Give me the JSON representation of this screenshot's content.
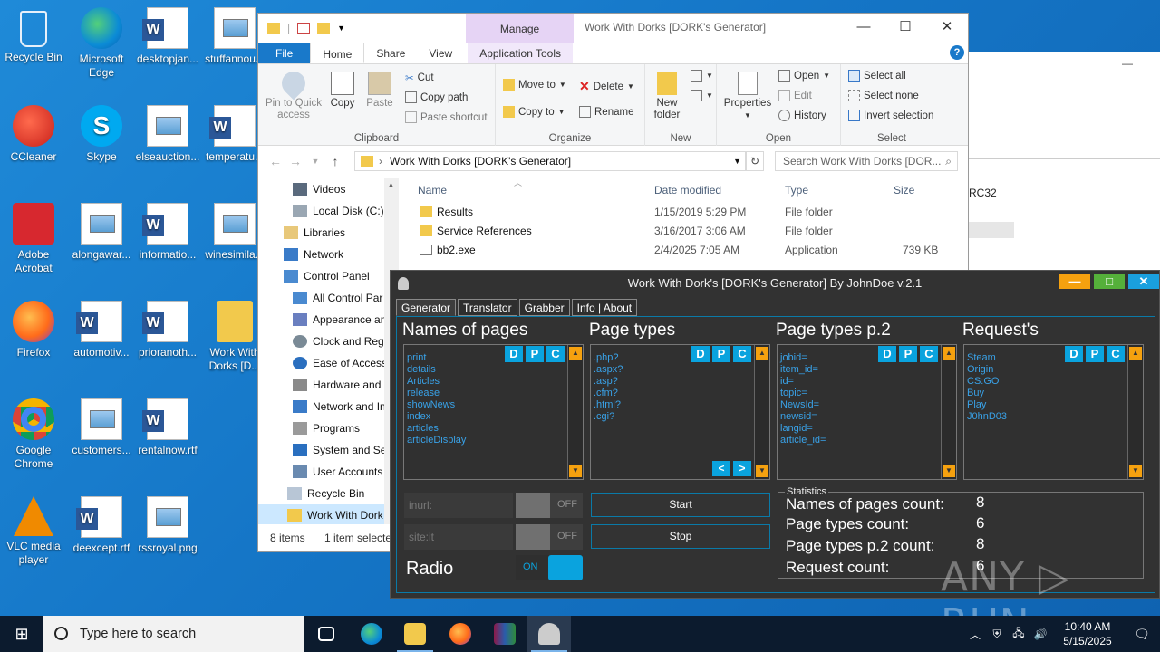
{
  "desktop": {
    "icons": [
      {
        "label": "Recycle Bin",
        "icon": "recycle-bin-icon"
      },
      {
        "label": "Microsoft Edge",
        "icon": "edge-icon"
      },
      {
        "label": "desktopjan...",
        "icon": "word-doc-icon"
      },
      {
        "label": "stuffannou...",
        "icon": "image-file-icon"
      },
      {
        "label": "CCleaner",
        "icon": "ccleaner-icon"
      },
      {
        "label": "Skype",
        "icon": "skype-icon"
      },
      {
        "label": "elseauction...",
        "icon": "image-file-icon"
      },
      {
        "label": "temperatu...",
        "icon": "word-doc-icon"
      },
      {
        "label": "Adobe Acrobat",
        "icon": "acrobat-icon"
      },
      {
        "label": "alongawar...",
        "icon": "image-file-icon"
      },
      {
        "label": "informatio...",
        "icon": "word-doc-icon"
      },
      {
        "label": "winesimila...",
        "icon": "image-file-icon"
      },
      {
        "label": "Firefox",
        "icon": "firefox-icon"
      },
      {
        "label": "automotiv...",
        "icon": "word-doc-icon"
      },
      {
        "label": "prioranoth...",
        "icon": "word-doc-icon"
      },
      {
        "label": "Work With Dorks [D...",
        "icon": "folder-icon"
      },
      {
        "label": "Google Chrome",
        "icon": "chrome-icon"
      },
      {
        "label": "customers...",
        "icon": "image-file-icon"
      },
      {
        "label": "rentalnow.rtf",
        "icon": "word-doc-icon"
      },
      {
        "label": "VLC media player",
        "icon": "vlc-icon"
      },
      {
        "label": "deexcept.rtf",
        "icon": "word-doc-icon"
      },
      {
        "label": "rssroyal.png",
        "icon": "image-file-icon"
      }
    ]
  },
  "explorer": {
    "title": "Work With Dorks [DORK's Generator]",
    "manage_label": "Manage",
    "tabs": {
      "file": "File",
      "home": "Home",
      "share": "Share",
      "view": "View",
      "app_tools": "Application Tools"
    },
    "help": "?",
    "ribbon": {
      "pin": "Pin to Quick access",
      "copy": "Copy",
      "paste": "Paste",
      "cut": "Cut",
      "copy_path": "Copy path",
      "paste_shortcut": "Paste shortcut",
      "clipboard": "Clipboard",
      "move_to": "Move to",
      "copy_to": "Copy to",
      "delete": "Delete",
      "rename": "Rename",
      "organize": "Organize",
      "new_folder": "New folder",
      "new": "New",
      "properties": "Properties",
      "open": "Open",
      "edit": "Edit",
      "history": "History",
      "open_group": "Open",
      "select_all": "Select all",
      "select_none": "Select none",
      "invert_selection": "Invert selection",
      "select": "Select"
    },
    "address": "Work With Dorks [DORK's Generator]",
    "search_placeholder": "Search Work With Dorks [DOR...",
    "nav_items": [
      {
        "label": "Videos",
        "icon": "videos-folder-icon"
      },
      {
        "label": "Local Disk (C:)",
        "icon": "drive-icon"
      },
      {
        "label": "Libraries",
        "icon": "libraries-icon"
      },
      {
        "label": "Network",
        "icon": "network-icon"
      },
      {
        "label": "Control Panel",
        "icon": "control-panel-icon"
      },
      {
        "label": "All Control Par",
        "icon": "control-panel-icon"
      },
      {
        "label": "Appearance an",
        "icon": "appearance-icon"
      },
      {
        "label": "Clock and Regi",
        "icon": "clock-icon"
      },
      {
        "label": "Ease of Access",
        "icon": "ease-access-icon"
      },
      {
        "label": "Hardware and",
        "icon": "hardware-icon"
      },
      {
        "label": "Network and In",
        "icon": "network-icon"
      },
      {
        "label": "Programs",
        "icon": "programs-icon"
      },
      {
        "label": "System and Se",
        "icon": "shield-icon"
      },
      {
        "label": "User Accounts",
        "icon": "users-icon"
      },
      {
        "label": "Recycle Bin",
        "icon": "recycle-bin-icon"
      },
      {
        "label": "Work With Dork",
        "icon": "folder-icon"
      }
    ],
    "columns": {
      "name": "Name",
      "date": "Date modified",
      "type": "Type",
      "size": "Size"
    },
    "files": [
      {
        "name": "Results",
        "date": "1/15/2019 5:29 PM",
        "type": "File folder",
        "size": ""
      },
      {
        "name": "Service References",
        "date": "3/16/2017 3:06 AM",
        "type": "File folder",
        "size": ""
      },
      {
        "name": "bb2.exe",
        "date": "2/4/2025 7:05 AM",
        "type": "Application",
        "size": "739 KB"
      }
    ],
    "status_items": "8 items",
    "status_selected": "1 item selecte"
  },
  "bg_window": {
    "text": "RC32"
  },
  "dork": {
    "title": "Work With Dork's [DORK's Generator] By JohnDoe v.2.1",
    "tabs": [
      "Generator",
      "Translator",
      "Grabber",
      "Info | About"
    ],
    "columns": [
      {
        "header": "Names of pages",
        "items": [
          "print",
          "details",
          "Articles",
          "release",
          "showNews",
          "index",
          "articles",
          "articleDisplay"
        ]
      },
      {
        "header": "Page types",
        "items": [
          ".php?",
          ".aspx?",
          ".asp?",
          ".cfm?",
          ".html?",
          ".cgi?"
        ]
      },
      {
        "header": "Page types p.2",
        "items": [
          "jobid=",
          "item_id=",
          "id=",
          "topic=",
          "NewsId=",
          "newsid=",
          "langid=",
          "article_id="
        ]
      },
      {
        "header": "Request's",
        "items": [
          "Steam",
          "Origin",
          "CS:GO",
          "Buy",
          "Play",
          "J0hnD03"
        ]
      }
    ],
    "btn_d": "D",
    "btn_p": "P",
    "btn_c": "C",
    "prev": "<",
    "next": ">",
    "inurl_placeholder": "inurl:",
    "site_placeholder": "site:it",
    "off_label": "OFF",
    "on_label": "ON",
    "radio_label": "Radio",
    "start": "Start",
    "stop": "Stop",
    "stats": {
      "legend": "Statistics",
      "names_label": "Names of pages count:",
      "names_value": "8",
      "types_label": "Page types count:",
      "types_value": "6",
      "types2_label": "Page types p.2 count:",
      "types2_value": "8",
      "request_label": "Request count:",
      "request_value": "6"
    }
  },
  "watermark": "ANY ▷ RUN",
  "taskbar": {
    "search_placeholder": "Type here to search",
    "time": "10:40 AM",
    "date": "5/15/2025"
  }
}
